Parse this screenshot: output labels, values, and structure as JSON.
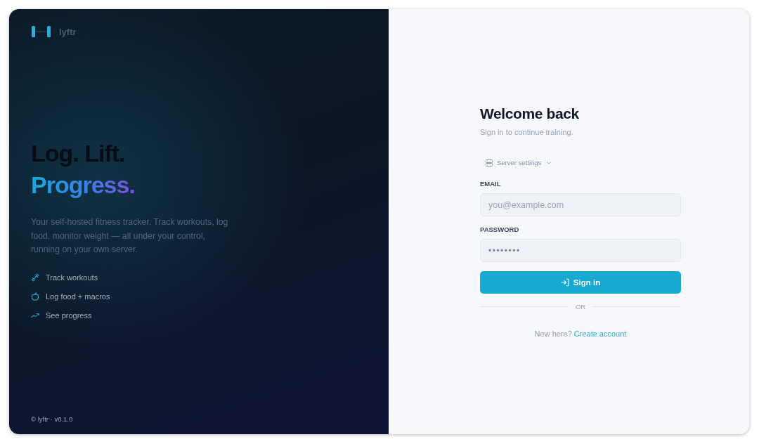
{
  "brand": {
    "name": "lyftr"
  },
  "hero": {
    "headline": "Log. Lift.",
    "highlight": "Progress.",
    "description": "Your self-hosted fitness tracker. Track workouts, log food, monitor weight — all under your control, running on your own server."
  },
  "features": [
    {
      "kind": "dumbbell",
      "label": "Track workouts"
    },
    {
      "kind": "apple",
      "label": "Log food + macros"
    },
    {
      "kind": "trend",
      "label": "See progress"
    }
  ],
  "footer": "© lyftr · v0.1.0",
  "login": {
    "title": "Welcome back",
    "subtitle": "Sign in to continue training.",
    "server_settings": {
      "label": "Server settings",
      "expanded": false
    },
    "fields": [
      {
        "kind": "email",
        "label": "EMAIL",
        "placeholder": "you@example.com"
      },
      {
        "kind": "password",
        "label": "PASSWORD",
        "value": "••••••••"
      }
    ],
    "submit": "Sign in",
    "divider": "OR",
    "signup_prompt": "New here?",
    "signup_link": "Create account"
  }
}
